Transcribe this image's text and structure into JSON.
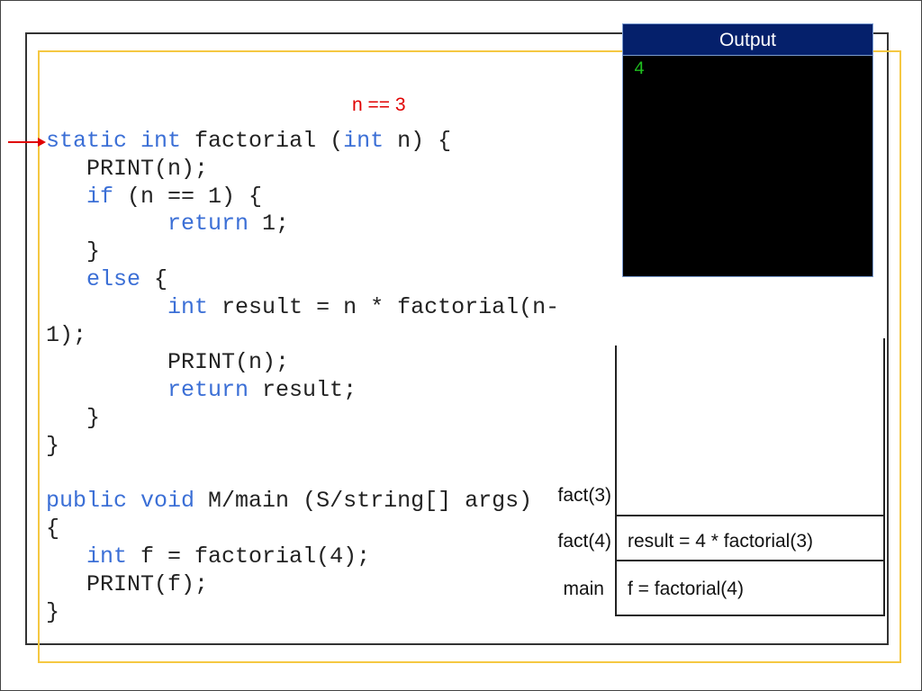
{
  "annotation": "n == 3",
  "code_lines": [
    [
      {
        "t": "static ",
        "kw": true
      },
      {
        "t": "int ",
        "kw": true
      },
      {
        "t": "factorial ("
      },
      {
        "t": "int",
        "kw": true
      },
      {
        "t": " n) {"
      }
    ],
    [
      {
        "t": "   PRINT(n);"
      }
    ],
    [
      {
        "t": "   "
      },
      {
        "t": "if",
        "kw": true
      },
      {
        "t": " (n == 1) {"
      }
    ],
    [
      {
        "t": "         "
      },
      {
        "t": "return",
        "kw": true
      },
      {
        "t": " 1;"
      }
    ],
    [
      {
        "t": "   }"
      }
    ],
    [
      {
        "t": "   "
      },
      {
        "t": "else",
        "kw": true
      },
      {
        "t": " {"
      }
    ],
    [
      {
        "t": "         "
      },
      {
        "t": "int",
        "kw": true
      },
      {
        "t": " result = n * factorial(n-"
      }
    ],
    [
      {
        "t": "1);"
      }
    ],
    [
      {
        "t": "         PRINT(n);"
      }
    ],
    [
      {
        "t": "         "
      },
      {
        "t": "return",
        "kw": true
      },
      {
        "t": " result;"
      }
    ],
    [
      {
        "t": "   }"
      }
    ],
    [
      {
        "t": "}"
      }
    ],
    [
      {
        "t": ""
      }
    ],
    [
      {
        "t": "public ",
        "kw": true
      },
      {
        "t": "void ",
        "kw": true
      },
      {
        "t": "M/main (S/string[] args)"
      }
    ],
    [
      {
        "t": "{"
      }
    ],
    [
      {
        "t": "   "
      },
      {
        "t": "int",
        "kw": true
      },
      {
        "t": " f = factorial(4);"
      }
    ],
    [
      {
        "t": "   PRINT(f);"
      }
    ],
    [
      {
        "t": "}"
      }
    ]
  ],
  "output": {
    "title": "Output",
    "text": "4"
  },
  "stack": {
    "frames": [
      {
        "label": "fact(3)",
        "content": ""
      },
      {
        "label": "fact(4)",
        "content": "result = 4 * factorial(3)"
      },
      {
        "label": "main",
        "content": "f = factorial(4)"
      }
    ]
  },
  "colors": {
    "keyword": "#3b6fd6",
    "annotation": "#e00000",
    "output_header": "#05206b",
    "output_text": "#1fbf1f",
    "frame_border": "#f5c842"
  }
}
